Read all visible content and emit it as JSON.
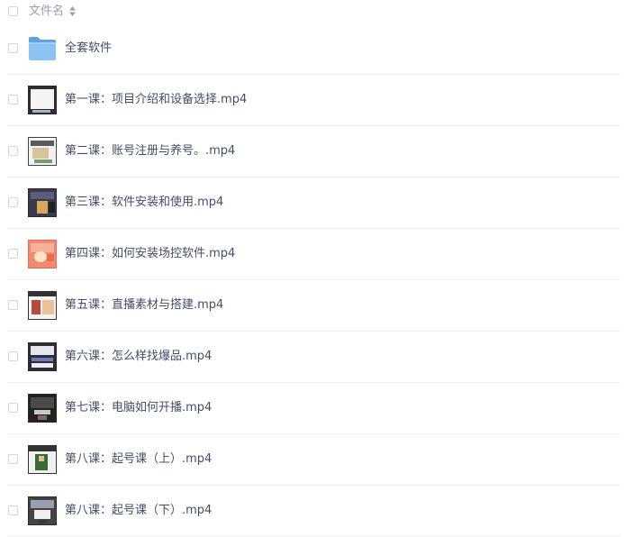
{
  "header": {
    "column_label": "文件名",
    "sort_icon": "sort-icon"
  },
  "files": [
    {
      "name": "全套软件",
      "type": "folder",
      "icon": "folder-icon"
    },
    {
      "name": "第一课：项目介绍和设备选择.mp4",
      "type": "video",
      "icon": "video-thumbnail"
    },
    {
      "name": "第二课：账号注册与养号。.mp4",
      "type": "video",
      "icon": "video-thumbnail"
    },
    {
      "name": "第三课：软件安装和使用.mp4",
      "type": "video",
      "icon": "video-thumbnail"
    },
    {
      "name": "第四课：如何安装场控软件.mp4",
      "type": "video",
      "icon": "video-thumbnail"
    },
    {
      "name": "第五课：直播素材与搭建.mp4",
      "type": "video",
      "icon": "video-thumbnail"
    },
    {
      "name": "第六课：怎么样找爆品.mp4",
      "type": "video",
      "icon": "video-thumbnail"
    },
    {
      "name": "第七课：电脑如何开播.mp4",
      "type": "video",
      "icon": "video-thumbnail"
    },
    {
      "name": "第八课：起号课（上）.mp4",
      "type": "video",
      "icon": "video-thumbnail"
    },
    {
      "name": "第八课：起号课（下）.mp4",
      "type": "video",
      "icon": "video-thumbnail"
    }
  ],
  "colors": {
    "folder": "#6fb1ec",
    "text": "#424e67",
    "header_text": "#9aa1ae",
    "divider": "#eef0f4"
  }
}
